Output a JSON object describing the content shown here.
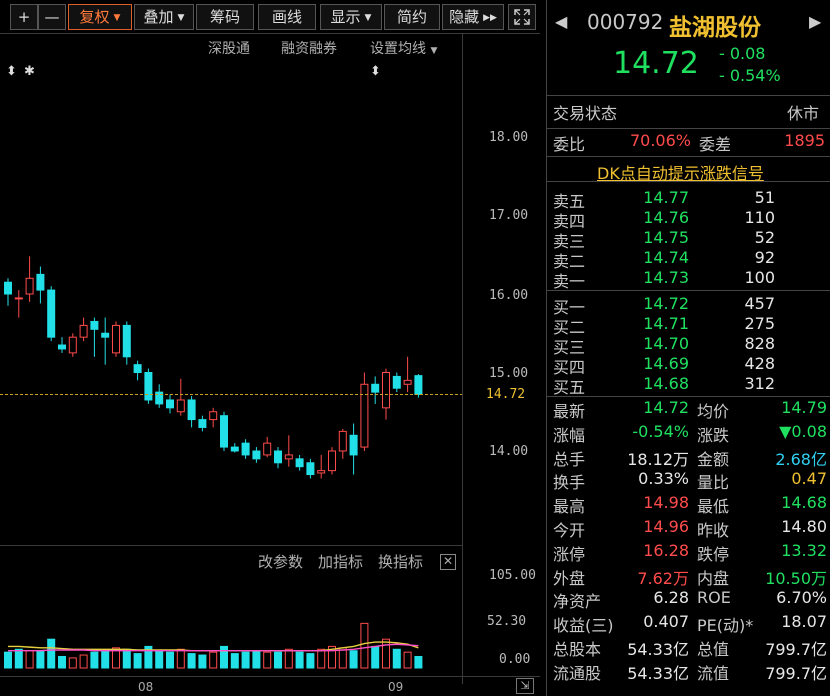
{
  "toolbar": {
    "plus": "+",
    "minus": "—",
    "fuquan": "复权",
    "diejia": "叠加",
    "chouma": "筹码",
    "huaxian": "画线",
    "xianshi": "显示",
    "jianyue": "简约",
    "yincang": "隐藏",
    "fullscreen_icon": "expand-icon"
  },
  "subtoolbar": {
    "shengutong": "深股通",
    "rongzi": "融资融券",
    "junxian": "设置均线"
  },
  "markers": [
    "⬍",
    "✱",
    "⬍"
  ],
  "price_axis": [
    "18.00",
    "17.00",
    "16.00",
    "15.00",
    "14.00"
  ],
  "current_price_tag": "14.72",
  "indicator_bar": {
    "gaicanshu": "改参数",
    "jiazhibiao": "加指标",
    "huanzhibiao": "换指标"
  },
  "volume_axis": [
    "105.00",
    "52.30",
    "0.00"
  ],
  "date_axis": [
    "08",
    "09"
  ],
  "colors": {
    "up": "#ff4b4b",
    "down": "#22e0e8",
    "price_green": "#20e060",
    "name_yellow": "#f0c030",
    "ma_yellow": "#e6d040",
    "ma_pink": "#ff50c8"
  },
  "chart_data": {
    "type": "candlestick",
    "ylim": [
      13.4,
      18.4
    ],
    "candles": [
      {
        "o": 16.15,
        "c": 16.0,
        "h": 16.2,
        "l": 15.85
      },
      {
        "o": 15.95,
        "c": 15.95,
        "h": 16.05,
        "l": 15.7
      },
      {
        "o": 16.0,
        "c": 16.2,
        "h": 16.48,
        "l": 15.9
      },
      {
        "o": 16.25,
        "c": 16.05,
        "h": 16.35,
        "l": 15.88
      },
      {
        "o": 16.05,
        "c": 15.45,
        "h": 16.1,
        "l": 15.4
      },
      {
        "o": 15.35,
        "c": 15.3,
        "h": 15.45,
        "l": 15.25
      },
      {
        "o": 15.25,
        "c": 15.45,
        "h": 15.5,
        "l": 15.2
      },
      {
        "o": 15.45,
        "c": 15.6,
        "h": 15.7,
        "l": 15.4
      },
      {
        "o": 15.65,
        "c": 15.55,
        "h": 15.7,
        "l": 15.2
      },
      {
        "o": 15.5,
        "c": 15.45,
        "h": 15.7,
        "l": 15.1
      },
      {
        "o": 15.25,
        "c": 15.6,
        "h": 15.65,
        "l": 15.2
      },
      {
        "o": 15.6,
        "c": 15.2,
        "h": 15.65,
        "l": 15.1
      },
      {
        "o": 15.1,
        "c": 15.0,
        "h": 15.15,
        "l": 14.9
      },
      {
        "o": 15.0,
        "c": 14.65,
        "h": 15.05,
        "l": 14.6
      },
      {
        "o": 14.75,
        "c": 14.6,
        "h": 14.85,
        "l": 14.55
      },
      {
        "o": 14.65,
        "c": 14.55,
        "h": 14.72,
        "l": 14.48
      },
      {
        "o": 14.5,
        "c": 14.65,
        "h": 14.92,
        "l": 14.45
      },
      {
        "o": 14.65,
        "c": 14.4,
        "h": 14.7,
        "l": 14.3
      },
      {
        "o": 14.4,
        "c": 14.3,
        "h": 14.45,
        "l": 14.25
      },
      {
        "o": 14.4,
        "c": 14.5,
        "h": 14.55,
        "l": 14.3
      },
      {
        "o": 14.45,
        "c": 14.05,
        "h": 14.5,
        "l": 14.0
      },
      {
        "o": 14.05,
        "c": 14.0,
        "h": 14.1,
        "l": 13.98
      },
      {
        "o": 14.1,
        "c": 13.95,
        "h": 14.15,
        "l": 13.9
      },
      {
        "o": 14.0,
        "c": 13.9,
        "h": 14.05,
        "l": 13.85
      },
      {
        "o": 13.95,
        "c": 14.1,
        "h": 14.18,
        "l": 13.92
      },
      {
        "o": 14.0,
        "c": 13.85,
        "h": 14.05,
        "l": 13.78
      },
      {
        "o": 13.9,
        "c": 13.95,
        "h": 14.2,
        "l": 13.8
      },
      {
        "o": 13.9,
        "c": 13.8,
        "h": 13.95,
        "l": 13.75
      },
      {
        "o": 13.85,
        "c": 13.7,
        "h": 13.9,
        "l": 13.65
      },
      {
        "o": 13.72,
        "c": 13.75,
        "h": 13.95,
        "l": 13.65
      },
      {
        "o": 13.75,
        "c": 14.0,
        "h": 14.05,
        "l": 13.7
      },
      {
        "o": 14.0,
        "c": 14.25,
        "h": 14.28,
        "l": 13.9
      },
      {
        "o": 14.2,
        "c": 13.95,
        "h": 14.35,
        "l": 13.7
      },
      {
        "o": 14.05,
        "c": 14.85,
        "h": 15.0,
        "l": 14.0
      },
      {
        "o": 14.85,
        "c": 14.75,
        "h": 14.95,
        "l": 14.6
      },
      {
        "o": 14.55,
        "c": 15.0,
        "h": 15.05,
        "l": 14.4
      },
      {
        "o": 14.95,
        "c": 14.8,
        "h": 15.0,
        "l": 14.75
      },
      {
        "o": 14.85,
        "c": 14.9,
        "h": 15.2,
        "l": 14.75
      },
      {
        "o": 14.96,
        "c": 14.72,
        "h": 14.98,
        "l": 14.68
      }
    ],
    "volumes": [
      22,
      26,
      24,
      24,
      40,
      16,
      14,
      18,
      22,
      24,
      28,
      26,
      20,
      30,
      24,
      22,
      26,
      20,
      18,
      22,
      30,
      20,
      22,
      24,
      22,
      22,
      26,
      22,
      20,
      26,
      30,
      28,
      24,
      62,
      30,
      40,
      26,
      22,
      16
    ],
    "volume_colors": [
      "down",
      "down",
      "up",
      "down",
      "down",
      "down",
      "up",
      "up",
      "down",
      "down",
      "up",
      "down",
      "down",
      "down",
      "down",
      "down",
      "up",
      "down",
      "down",
      "up",
      "down",
      "down",
      "down",
      "down",
      "up",
      "down",
      "up",
      "down",
      "down",
      "up",
      "up",
      "up",
      "down",
      "up",
      "down",
      "up",
      "down",
      "up",
      "down"
    ],
    "ma_yellow": [
      30,
      30,
      29,
      28,
      28,
      27,
      26,
      26,
      26,
      26,
      26,
      26,
      25,
      25,
      25,
      25,
      25,
      24,
      24,
      24,
      24,
      24,
      24,
      24,
      24,
      24,
      24,
      24,
      24,
      24,
      26,
      28,
      30,
      34,
      36,
      36,
      35,
      33,
      28
    ],
    "ma_pink": [
      24,
      24,
      24,
      24,
      25,
      25,
      25,
      25,
      24,
      24,
      24,
      24,
      24,
      24,
      24,
      24,
      24,
      24,
      24,
      24,
      24,
      24,
      24,
      24,
      24,
      24,
      24,
      24,
      24,
      24,
      24,
      25,
      26,
      28,
      30,
      32,
      33,
      32,
      31
    ]
  },
  "quote": {
    "code": "000792",
    "name": "盐湖股份",
    "last": "14.72",
    "chg_abs": "- 0.08",
    "chg_pct": "- 0.54%",
    "trade_status_label": "交易状态",
    "trade_status": "休市",
    "weibi_label": "委比",
    "weibi": "70.06%",
    "weicha_label": "委差",
    "weicha": "1895",
    "signal": "DK点自动提示涨跌信号",
    "asks": [
      {
        "label": "卖五",
        "price": "14.77",
        "vol": "51"
      },
      {
        "label": "卖四",
        "price": "14.76",
        "vol": "110"
      },
      {
        "label": "卖三",
        "price": "14.75",
        "vol": "52"
      },
      {
        "label": "卖二",
        "price": "14.74",
        "vol": "92"
      },
      {
        "label": "卖一",
        "price": "14.73",
        "vol": "100"
      }
    ],
    "bids": [
      {
        "label": "买一",
        "price": "14.72",
        "vol": "457"
      },
      {
        "label": "买二",
        "price": "14.71",
        "vol": "275"
      },
      {
        "label": "买三",
        "price": "14.70",
        "vol": "828"
      },
      {
        "label": "买四",
        "price": "14.69",
        "vol": "428"
      },
      {
        "label": "买五",
        "price": "14.68",
        "vol": "312"
      }
    ],
    "stats": [
      {
        "l1": "最新",
        "v1": "14.72",
        "c1": "green",
        "l2": "均价",
        "v2": "14.79",
        "c2": "green"
      },
      {
        "l1": "涨幅",
        "v1": "-0.54%",
        "c1": "green",
        "l2": "涨跌",
        "v2": "▼0.08",
        "c2": "green"
      },
      {
        "l1": "总手",
        "v1": "18.12万",
        "c1": "white",
        "l2": "金额",
        "v2": "2.68亿",
        "c2": "cyan"
      },
      {
        "l1": "换手",
        "v1": "0.33%",
        "c1": "white",
        "l2": "量比",
        "v2": "0.47",
        "c2": "yellow"
      },
      {
        "l1": "最高",
        "v1": "14.98",
        "c1": "red",
        "l2": "最低",
        "v2": "14.68",
        "c2": "green"
      },
      {
        "l1": "今开",
        "v1": "14.96",
        "c1": "red",
        "l2": "昨收",
        "v2": "14.80",
        "c2": "white"
      },
      {
        "l1": "涨停",
        "v1": "16.28",
        "c1": "red",
        "l2": "跌停",
        "v2": "13.32",
        "c2": "green"
      },
      {
        "l1": "外盘",
        "v1": "7.62万",
        "c1": "red",
        "l2": "内盘",
        "v2": "10.50万",
        "c2": "green"
      },
      {
        "l1": "净资产",
        "v1": "6.28",
        "c1": "white",
        "l2": "ROE",
        "v2": "6.70%",
        "c2": "white"
      },
      {
        "l1": "收益(三)",
        "v1": "0.407",
        "c1": "white",
        "l2": "PE(动)*",
        "v2": "18.07",
        "c2": "white"
      },
      {
        "l1": "总股本",
        "v1": "54.33亿",
        "c1": "white",
        "l2": "总值",
        "v2": "799.7亿",
        "c2": "white"
      },
      {
        "l1": "流通股",
        "v1": "54.33亿",
        "c1": "white",
        "l2": "流值",
        "v2": "799.7亿",
        "c2": "white"
      }
    ]
  }
}
